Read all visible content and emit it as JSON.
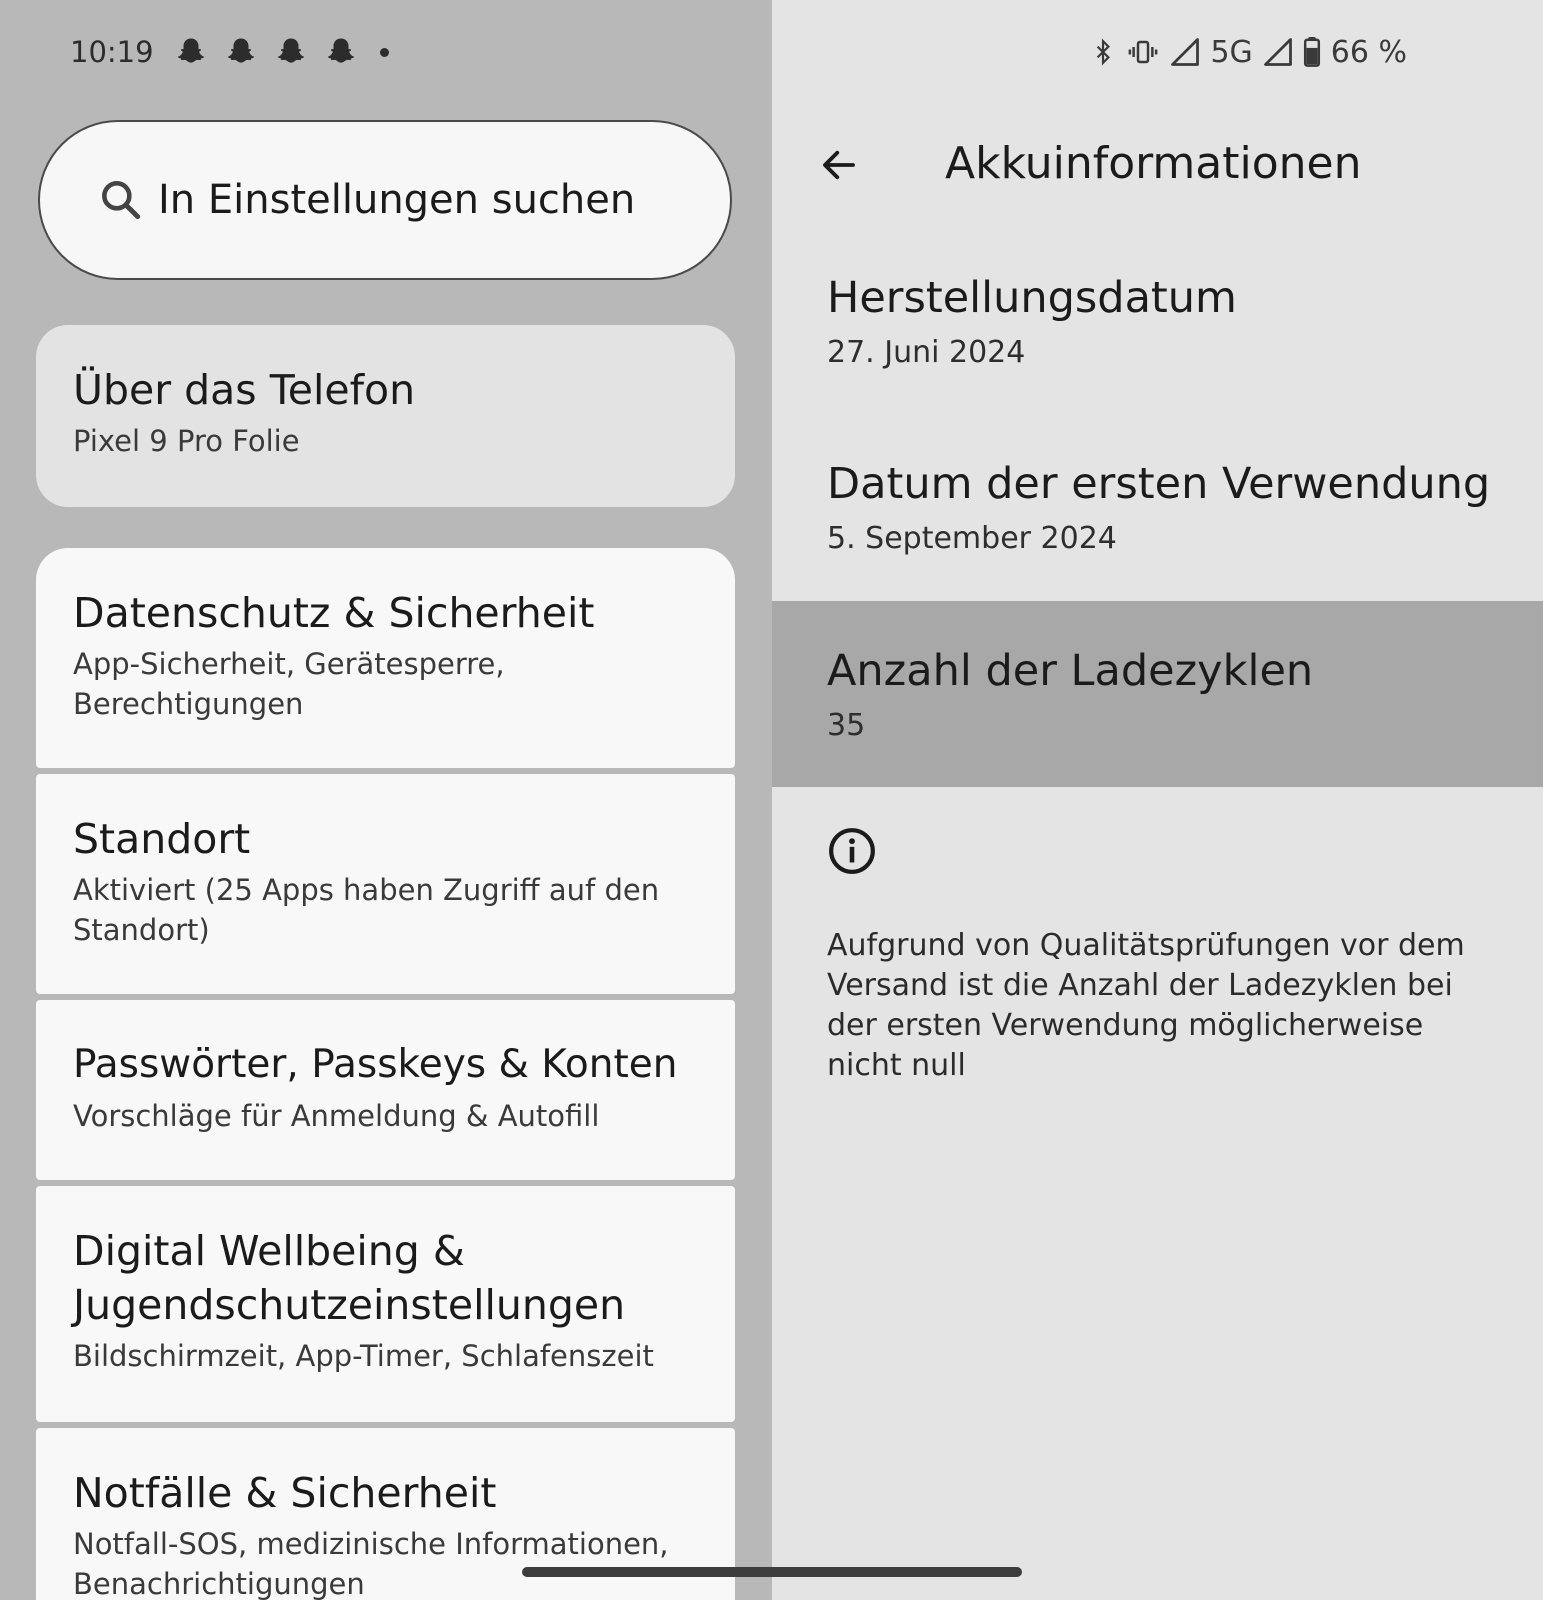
{
  "status_bar": {
    "time": "10:19",
    "notification_icons": [
      "snapchat-icon",
      "snapchat-icon",
      "snapchat-icon",
      "snapchat-icon"
    ],
    "network": "5G",
    "battery": "66 %"
  },
  "search": {
    "placeholder": "In Einstellungen suchen"
  },
  "settings_list": {
    "items": [
      {
        "title": "Über das Telefon",
        "subtitle": "Pixel 9 Pro Folie"
      },
      {
        "title": "Datenschutz & Sicherheit",
        "subtitle": "App-Sicherheit, Gerätesperre, Berechtigungen"
      },
      {
        "title": "Standort",
        "subtitle": "Aktiviert (25 Apps haben Zugriff auf den Standort)"
      },
      {
        "title": "Passwörter, Passkeys & Konten",
        "subtitle": "Vorschläge für Anmeldung & Autofill"
      },
      {
        "title": "Digital Wellbeing & Jugendschutzeinstellungen",
        "subtitle": "Bildschirmzeit, App-Timer, Schlafenszeit"
      },
      {
        "title": "Notfälle & Sicherheit",
        "subtitle": "Notfall-SOS, medizinische Informationen, Benachrichtigungen"
      }
    ]
  },
  "detail": {
    "title": "Akkuinformationen",
    "rows": [
      {
        "label": "Herstellungsdatum",
        "value": "27. Juni 2024"
      },
      {
        "label": "Datum der ersten Verwendung",
        "value": "5. September 2024"
      },
      {
        "label": "Anzahl der Ladezyklen",
        "value": "35"
      }
    ],
    "info_text": "Aufgrund von Qualitätsprüfungen vor dem Versand ist die Anzahl der Ladezyklen bei der ersten Verwendung möglicherweise nicht null"
  },
  "colors": {
    "left_background": "#b8b8b8",
    "right_background": "#e4e4e4",
    "selected_row": "#a8a8a8",
    "card_background": "#f8f8f8"
  }
}
